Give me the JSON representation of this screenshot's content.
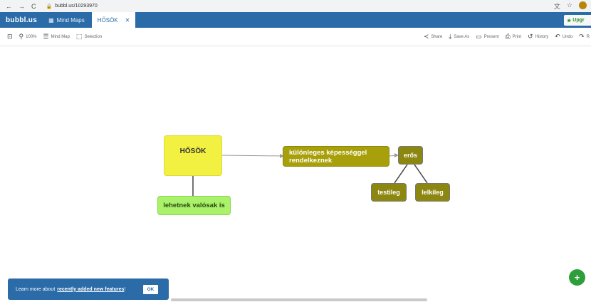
{
  "browser": {
    "url": "bubbl.us/10293970"
  },
  "app": {
    "logo": "bubbl.us",
    "tab_mindmaps": "Mind Maps",
    "tab_active": "HŐSÖK",
    "upgrade_label": "Upgr"
  },
  "toolbar": {
    "zoom": "100%",
    "mindmap_label": "Mind Map",
    "selection_label": "Selection",
    "share_label": "Share",
    "saveas_label": "Save As",
    "present_label": "Present",
    "print_label": "Print",
    "history_label": "History",
    "undo_label": "Undo",
    "redo_label": "R"
  },
  "nodes": {
    "root": "HŐSÖK",
    "special": "különleges képességgel rendelkeznek",
    "eros": "erős",
    "testileg": "testileg",
    "lelkileg": "lelkileg",
    "valos": "lehetnek valósak is"
  },
  "toast": {
    "text": "Learn more about",
    "link": "recently added new features",
    "suffix": "!",
    "ok": "OK"
  },
  "colors": {
    "appbar": "#2b6ca8",
    "root_node": "#f2f040",
    "olive_node": "#a8a00a",
    "dark_olive_node": "#8c8710",
    "green_node": "#a9f26a",
    "fab": "#2e9e3a"
  }
}
